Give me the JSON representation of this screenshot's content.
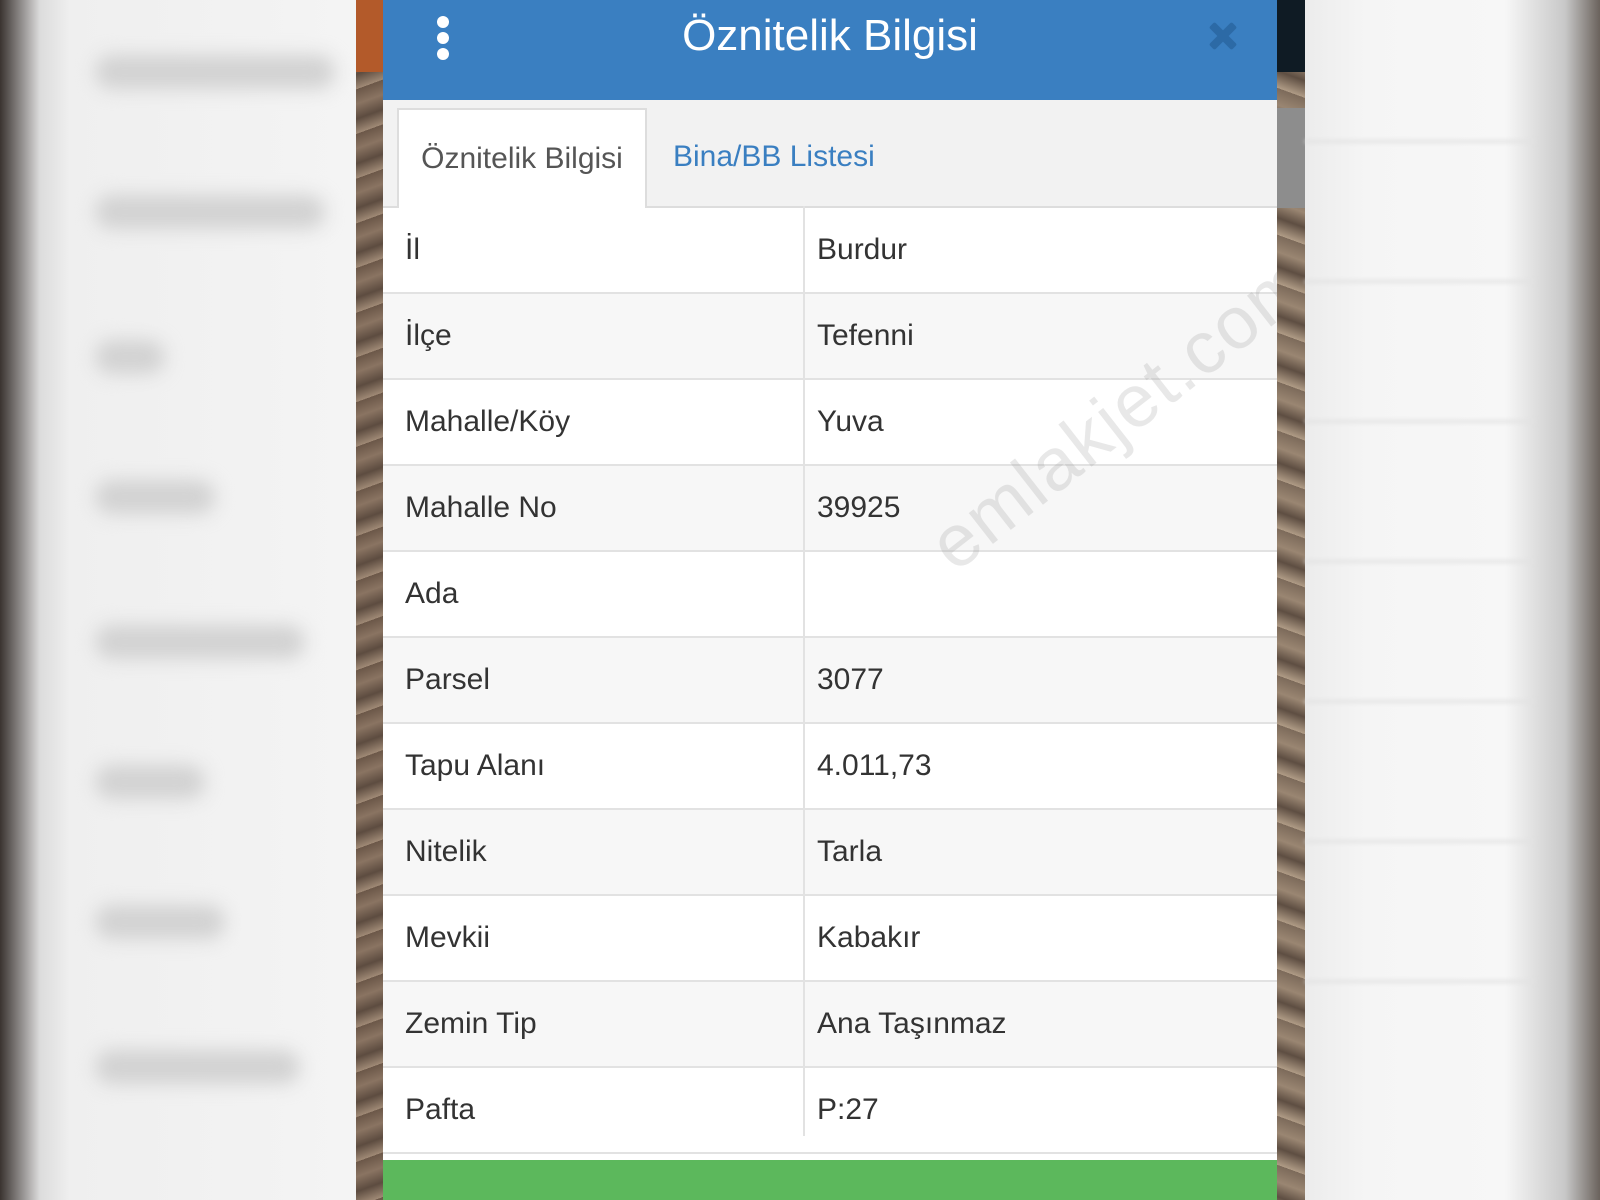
{
  "dialog": {
    "title": "Öznitelik Bilgisi",
    "menu_icon": "vertical-dots-icon",
    "close_icon": "close-icon"
  },
  "tabs": [
    {
      "label": "Öznitelik Bilgisi",
      "active": true
    },
    {
      "label": "Bina/BB Listesi",
      "active": false
    }
  ],
  "attributes": [
    {
      "key": "İl",
      "value": "Burdur"
    },
    {
      "key": "İlçe",
      "value": "Tefenni"
    },
    {
      "key": "Mahalle/Köy",
      "value": "Yuva"
    },
    {
      "key": "Mahalle No",
      "value": "39925"
    },
    {
      "key": "Ada",
      "value": ""
    },
    {
      "key": "Parsel",
      "value": "3077"
    },
    {
      "key": "Tapu Alanı",
      "value": "4.011,73"
    },
    {
      "key": "Nitelik",
      "value": "Tarla"
    },
    {
      "key": "Mevkii",
      "value": "Kabakır"
    },
    {
      "key": "Zemin Tip",
      "value": "Ana Taşınmaz"
    },
    {
      "key": "Pafta",
      "value": "P:27"
    }
  ],
  "watermark": "emlakjet.com",
  "colors": {
    "header": "#3a7fc1",
    "tab_link": "#3a7fc1",
    "footer": "#5cb85c"
  }
}
